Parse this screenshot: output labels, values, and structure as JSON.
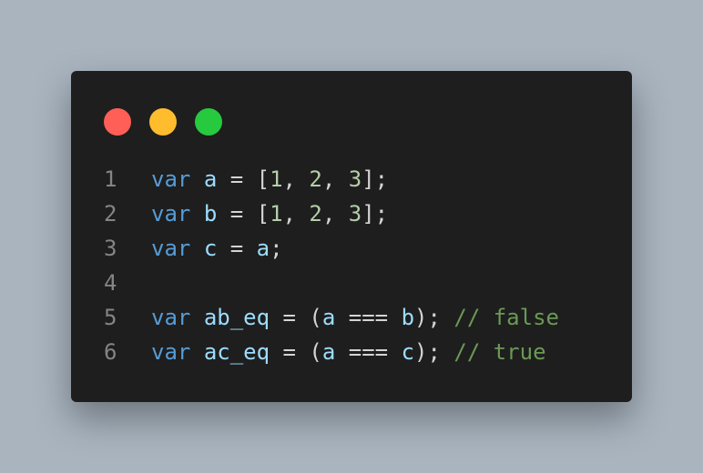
{
  "window": {
    "controls": [
      {
        "name": "close",
        "color": "#ff5f56"
      },
      {
        "name": "minimize",
        "color": "#ffbd2e"
      },
      {
        "name": "maximize",
        "color": "#27c93f"
      }
    ]
  },
  "code": {
    "lines": [
      {
        "number": "1",
        "tokens": [
          {
            "type": "kw",
            "text": "var"
          },
          {
            "type": "pn",
            "text": " "
          },
          {
            "type": "id",
            "text": "a"
          },
          {
            "type": "pn",
            "text": " = ["
          },
          {
            "type": "num",
            "text": "1"
          },
          {
            "type": "pn",
            "text": ", "
          },
          {
            "type": "num",
            "text": "2"
          },
          {
            "type": "pn",
            "text": ", "
          },
          {
            "type": "num",
            "text": "3"
          },
          {
            "type": "pn",
            "text": "];"
          }
        ]
      },
      {
        "number": "2",
        "tokens": [
          {
            "type": "kw",
            "text": "var"
          },
          {
            "type": "pn",
            "text": " "
          },
          {
            "type": "id",
            "text": "b"
          },
          {
            "type": "pn",
            "text": " = ["
          },
          {
            "type": "num",
            "text": "1"
          },
          {
            "type": "pn",
            "text": ", "
          },
          {
            "type": "num",
            "text": "2"
          },
          {
            "type": "pn",
            "text": ", "
          },
          {
            "type": "num",
            "text": "3"
          },
          {
            "type": "pn",
            "text": "];"
          }
        ]
      },
      {
        "number": "3",
        "tokens": [
          {
            "type": "kw",
            "text": "var"
          },
          {
            "type": "pn",
            "text": " "
          },
          {
            "type": "id",
            "text": "c"
          },
          {
            "type": "pn",
            "text": " = "
          },
          {
            "type": "id",
            "text": "a"
          },
          {
            "type": "pn",
            "text": ";"
          }
        ]
      },
      {
        "number": "4",
        "tokens": []
      },
      {
        "number": "5",
        "tokens": [
          {
            "type": "kw",
            "text": "var"
          },
          {
            "type": "pn",
            "text": " "
          },
          {
            "type": "id",
            "text": "ab_eq"
          },
          {
            "type": "pn",
            "text": " = ("
          },
          {
            "type": "id",
            "text": "a"
          },
          {
            "type": "pn",
            "text": " === "
          },
          {
            "type": "id",
            "text": "b"
          },
          {
            "type": "pn",
            "text": "); "
          },
          {
            "type": "cm",
            "text": "// false"
          }
        ]
      },
      {
        "number": "6",
        "tokens": [
          {
            "type": "kw",
            "text": "var"
          },
          {
            "type": "pn",
            "text": " "
          },
          {
            "type": "id",
            "text": "ac_eq"
          },
          {
            "type": "pn",
            "text": " = ("
          },
          {
            "type": "id",
            "text": "a"
          },
          {
            "type": "pn",
            "text": " === "
          },
          {
            "type": "id",
            "text": "c"
          },
          {
            "type": "pn",
            "text": "); "
          },
          {
            "type": "cm",
            "text": "// true"
          }
        ]
      }
    ]
  }
}
